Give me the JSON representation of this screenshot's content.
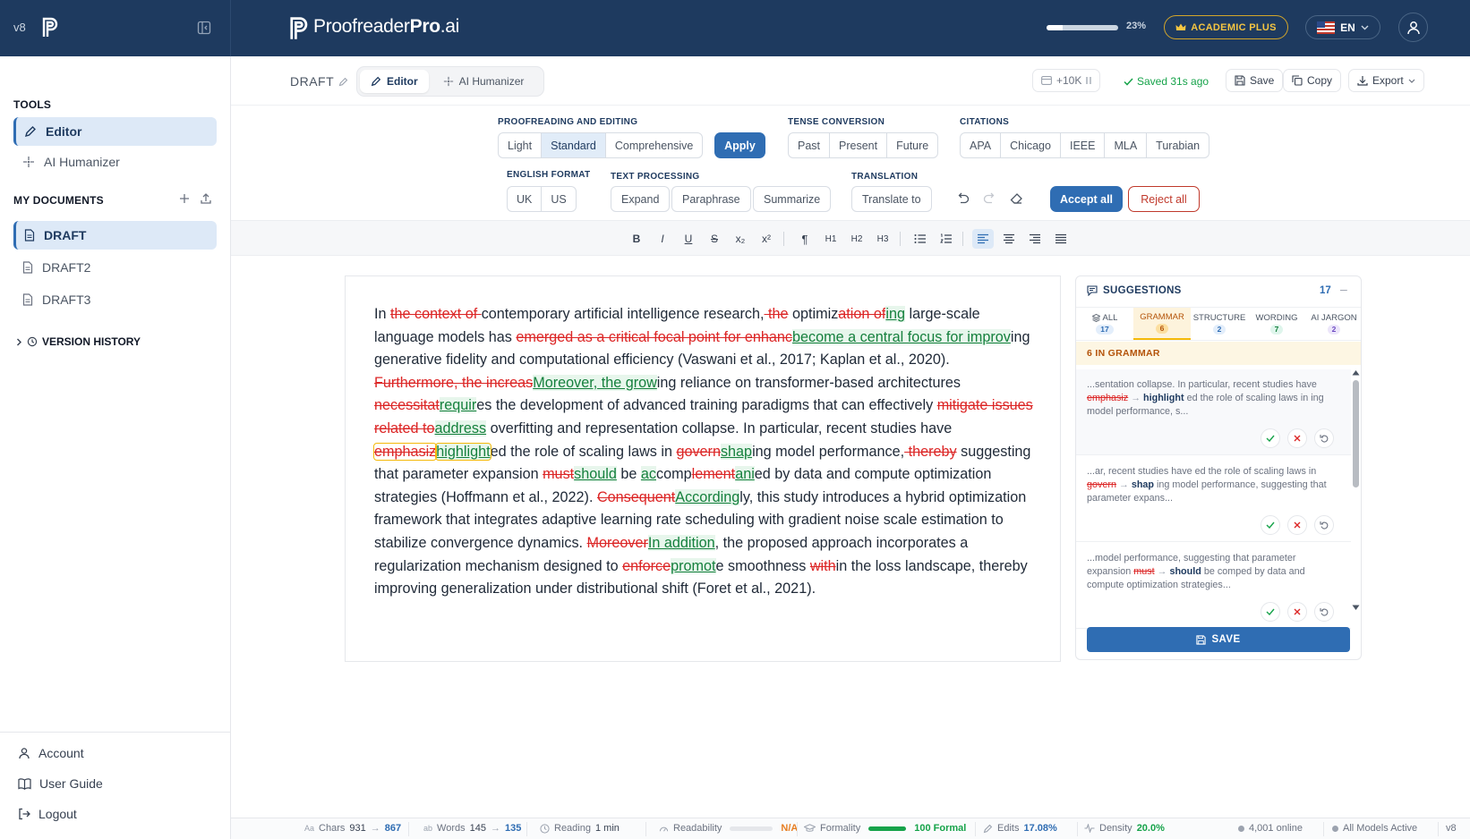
{
  "app": {
    "version": "v8",
    "brand_regular": "Proofreader",
    "brand_bold": "Pro",
    "brand_suffix": ".ai",
    "progress_value": 0.23,
    "progress_label": "23%",
    "plan": "ACADEMIC PLUS",
    "language": "EN"
  },
  "sidebar": {
    "tools_label": "TOOLS",
    "tools": [
      {
        "label": "Editor",
        "icon": "pen-icon",
        "active": true
      },
      {
        "label": "AI Humanizer",
        "icon": "sparkle-icon",
        "active": false
      }
    ],
    "documents_label": "MY DOCUMENTS",
    "documents": [
      {
        "label": "DRAFT",
        "active": true
      },
      {
        "label": "DRAFT2",
        "active": false
      },
      {
        "label": "DRAFT3",
        "active": false
      }
    ],
    "version_history": "VERSION HISTORY",
    "bottom": [
      {
        "label": "Account",
        "icon": "user-icon"
      },
      {
        "label": "User Guide",
        "icon": "book-icon"
      },
      {
        "label": "Logout",
        "icon": "logout-icon"
      }
    ]
  },
  "docbar": {
    "title": "DRAFT",
    "tabs": [
      {
        "label": "Editor",
        "active": true
      },
      {
        "label": "AI Humanizer",
        "active": false
      }
    ],
    "credits": "+10K",
    "saved": "Saved 31s ago",
    "save": "Save",
    "copy": "Copy",
    "export": "Export"
  },
  "toolbar": {
    "proofreading_label": "PROOFREADING AND EDITING",
    "proofreading_options": [
      "Light",
      "Standard",
      "Comprehensive"
    ],
    "proofreading_selected": "Standard",
    "apply": "Apply",
    "tense_label": "TENSE CONVERSION",
    "tense_options": [
      "Past",
      "Present",
      "Future"
    ],
    "citations_label": "CITATIONS",
    "citation_options": [
      "APA",
      "Chicago",
      "IEEE",
      "MLA",
      "Turabian"
    ],
    "english_label": "ENGLISH FORMAT",
    "english_options": [
      "UK",
      "US"
    ],
    "text_processing_label": "TEXT PROCESSING",
    "text_processing_options": [
      "Expand",
      "Paraphrase",
      "Summarize"
    ],
    "translation_label": "TRANSLATION",
    "translate_to": "Translate to",
    "accept_all": "Accept all",
    "reject_all": "Reject all"
  },
  "format": {
    "buttons": [
      "B",
      "I",
      "U",
      "S",
      "x₂",
      "x²",
      "¶",
      "H1",
      "H2",
      "H3"
    ]
  },
  "editor": {
    "segments": [
      {
        "t": "n",
        "s": "In "
      },
      {
        "t": "d",
        "s": "the context of "
      },
      {
        "t": "n",
        "s": "contemporary artificial intelligence research,"
      },
      {
        "t": "d",
        "s": " the"
      },
      {
        "t": "n",
        "s": " optimiz"
      },
      {
        "t": "d",
        "s": "ation of"
      },
      {
        "t": "i",
        "s": "ing"
      },
      {
        "t": "n",
        "s": " large-scale language models has "
      },
      {
        "t": "d",
        "s": "emerged as a critical focal point for enhanc"
      },
      {
        "t": "i",
        "s": "become a central focus for improv"
      },
      {
        "t": "n",
        "s": "ing generative fidelity and computational efficiency (Vaswani et al., 2017; Kaplan et al., 2020). "
      },
      {
        "t": "d",
        "s": "Furthermore, the increas"
      },
      {
        "t": "i",
        "s": "Moreover, the grow"
      },
      {
        "t": "n",
        "s": "ing reliance on transformer-based architectures "
      },
      {
        "t": "d",
        "s": "necessitat"
      },
      {
        "t": "i",
        "s": "requir"
      },
      {
        "t": "n",
        "s": "es the development of advanced training paradigms that can effectively "
      },
      {
        "t": "d",
        "s": "mitigate issues related to"
      },
      {
        "t": "i",
        "s": "address"
      },
      {
        "t": "n",
        "s": " overfitting and representation collapse. In particular, recent studies have "
      },
      {
        "t": "hd",
        "s": "emphasiz"
      },
      {
        "t": "hi",
        "s": "highlight"
      },
      {
        "t": "n",
        "s": "ed the role of scaling laws in "
      },
      {
        "t": "d",
        "s": "govern"
      },
      {
        "t": "i",
        "s": "shap"
      },
      {
        "t": "n",
        "s": "ing model performance,"
      },
      {
        "t": "d",
        "s": " thereby"
      },
      {
        "t": "n",
        "s": " suggesting that parameter expansion "
      },
      {
        "t": "d",
        "s": "must"
      },
      {
        "t": "i",
        "s": "should"
      },
      {
        "t": "n",
        "s": " be "
      },
      {
        "t": "i",
        "s": "ac"
      },
      {
        "t": "n",
        "s": "comp"
      },
      {
        "t": "d",
        "s": "lement"
      },
      {
        "t": "i",
        "s": "ani"
      },
      {
        "t": "n",
        "s": "ed by data and compute optimization strategies (Hoffmann et al., 2022). "
      },
      {
        "t": "d",
        "s": "Consequent"
      },
      {
        "t": "i",
        "s": "According"
      },
      {
        "t": "n",
        "s": "ly, this study introduces a hybrid optimization framework that integrates adaptive learning rate scheduling with gradient noise scale estimation to stabilize convergence dynamics. "
      },
      {
        "t": "d",
        "s": "Moreover"
      },
      {
        "t": "i",
        "s": "In addition"
      },
      {
        "t": "n",
        "s": ", the proposed approach incorporates a regularization mechanism designed to "
      },
      {
        "t": "d",
        "s": "enforce"
      },
      {
        "t": "i",
        "s": "promot"
      },
      {
        "t": "n",
        "s": "e smoothness "
      },
      {
        "t": "d",
        "s": "with"
      },
      {
        "t": "n",
        "s": "in the loss landscape, thereby improving generalization under distributional shift (Foret et al., 2021)."
      }
    ]
  },
  "suggestions": {
    "title": "SUGGESTIONS",
    "count": "17",
    "tabs": [
      {
        "label": "ALL",
        "count": "17"
      },
      {
        "label": "GRAMMAR",
        "count": "6"
      },
      {
        "label": "STRUCTURE",
        "count": "2"
      },
      {
        "label": "WORDING",
        "count": "7"
      },
      {
        "label": "AI JARGON",
        "count": "2"
      }
    ],
    "active_tab": "GRAMMAR",
    "section_label": "6 IN GRAMMAR",
    "items": [
      {
        "before": "...sentation collapse. In particular, recent studies have ",
        "old": "emphasiz",
        "arrow": "→",
        "new": "highlight",
        "after": "ed the role of scaling laws in ing model performance, s..."
      },
      {
        "before": "...ar, recent studies have ed the role of scaling laws in ",
        "old": "govern",
        "arrow": "→",
        "new": "shap",
        "after": "ing model performance, suggesting that parameter expans..."
      },
      {
        "before": "...model performance, suggesting that parameter expansion ",
        "old": "must",
        "arrow": "→",
        "new": "should",
        "after": "be comped by data and compute optimization strategies..."
      }
    ],
    "save": "SAVE"
  },
  "status": {
    "chars_label": "Chars",
    "chars_from": "931",
    "chars_to": "867",
    "words_label": "Words",
    "words_from": "145",
    "words_to": "135",
    "reading_label": "Reading",
    "reading_value": "1 min",
    "readability_label": "Readability",
    "readability_value": "N/A",
    "formality_label": "Formality",
    "formality_level": 1.0,
    "formality_value": "100 Formal",
    "edits_label": "Edits",
    "edits_value": "17.08%",
    "density_label": "Density",
    "density_value": "20.0%",
    "online": "4,001 online",
    "models": "All Models Active",
    "version": "v8"
  },
  "colors": {
    "navy": "#1e3a5f",
    "accent": "#2f6db3",
    "deletion": "#dc2626",
    "insertion": "#15803d",
    "highlight": "#f5b90a",
    "gold": "#f5c542"
  }
}
